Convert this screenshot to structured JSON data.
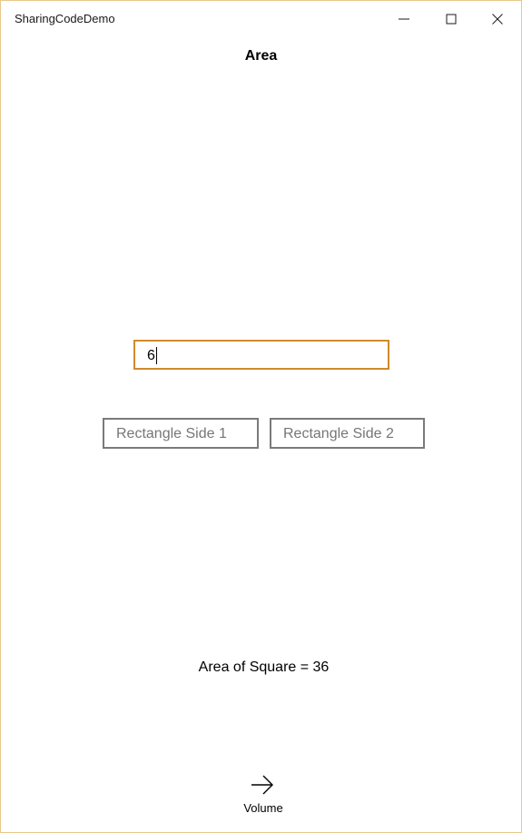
{
  "window": {
    "app_title": "SharingCodeDemo",
    "border_color": "#e8c98c"
  },
  "caption_buttons": {
    "minimize_icon": "minimize-icon",
    "maximize_icon": "maximize-icon",
    "close_icon": "close-icon"
  },
  "page": {
    "title": "Area"
  },
  "square_side_input": {
    "value": "6",
    "focused": true,
    "focus_color": "#d08a2c"
  },
  "rectangle_inputs": [
    {
      "placeholder": "Rectangle Side 1",
      "value": ""
    },
    {
      "placeholder": "Rectangle Side 2",
      "value": ""
    }
  ],
  "result": {
    "text": "Area of Square = 36"
  },
  "navigation": {
    "volume_icon": "arrow-right-icon",
    "volume_label": "Volume"
  }
}
